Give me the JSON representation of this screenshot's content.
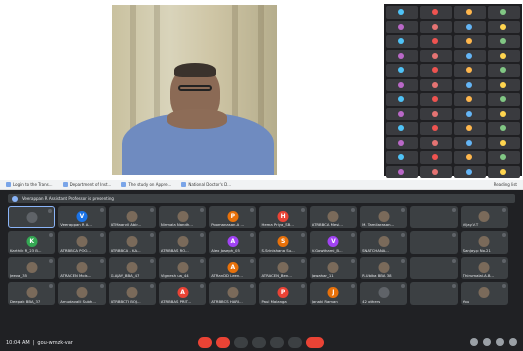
{
  "thumb_grid": {
    "rows": 13,
    "dot_colors": [
      "#4fc3f7",
      "#ef5350",
      "#ffb74d",
      "#81c784",
      "#ba68c8",
      "#e57373",
      "#64b5f6",
      "#ffd54f"
    ]
  },
  "browser": {
    "bookmarks": [
      {
        "label": "Login to the Trans..."
      },
      {
        "label": "Department of Inst..."
      },
      {
        "label": "The study on Appre..."
      },
      {
        "label": "National Doctor's D..."
      }
    ],
    "reading_list": "Reading list"
  },
  "meet": {
    "presenting_banner": "Veerappan R Assistant Professor is presenting",
    "tiles": [
      {
        "name": "",
        "initial": "",
        "color": "#5f6368",
        "presenting": true
      },
      {
        "name": "Veerappan R A...",
        "initial": "V",
        "color": "#1a73e8"
      },
      {
        "name": "ATMaarvil Abir...",
        "initial": "",
        "color": "#7a6a5a"
      },
      {
        "name": "Nirmala Nandh...",
        "initial": "",
        "color": "#7a6a5a"
      },
      {
        "name": "Poomanasan.A ...",
        "initial": "P",
        "color": "#e8710a"
      },
      {
        "name": "Hema Priya_SB...",
        "initial": "H",
        "color": "#ea4335"
      },
      {
        "name": "ATRBBCA Mesi...",
        "initial": "",
        "color": "#7a6a5a"
      },
      {
        "name": "M. Tamilarasan...",
        "initial": "",
        "color": "#7a6a5a"
      },
      {
        "name": "",
        "initial": "",
        "color": "#3c4043"
      },
      {
        "name": "Vijay.V.T",
        "initial": "",
        "color": "#7a6a5a"
      },
      {
        "name": "Karthik R_23 B...",
        "initial": "K",
        "color": "#34a853"
      },
      {
        "name": "ATRBBCA POO...",
        "initial": "",
        "color": "#7a6a5a"
      },
      {
        "name": "ATRBBCA - KA...",
        "initial": "",
        "color": "#7a6a5a"
      },
      {
        "name": "ATRBBAS RO...",
        "initial": "",
        "color": "#7a6a5a"
      },
      {
        "name": "Alex Joseph_05",
        "initial": "A",
        "color": "#a142f4"
      },
      {
        "name": "S.Srinishana Su...",
        "initial": "S",
        "color": "#e8710a"
      },
      {
        "name": "V.Gowthami_B...",
        "initial": "V",
        "color": "#a142f4"
      },
      {
        "name": "SNATCHANA...",
        "initial": "",
        "color": "#7a6a5a"
      },
      {
        "name": "",
        "initial": "",
        "color": "#3c4043"
      },
      {
        "name": "Sanjay.p No.21",
        "initial": "",
        "color": "#7a6a5a"
      },
      {
        "name": "Jeeva_35",
        "initial": "",
        "color": "#7a6a5a"
      },
      {
        "name": "ATRACEN Mois...",
        "initial": "",
        "color": "#7a6a5a"
      },
      {
        "name": "G.AJAY_BBA_47",
        "initial": "",
        "color": "#7a6a5a"
      },
      {
        "name": "Vignesh ua_44",
        "initial": "",
        "color": "#7a6a5a"
      },
      {
        "name": "ATRanDD Leen...",
        "initial": "A",
        "color": "#e8710a"
      },
      {
        "name": "ATRACEN_Ben...",
        "initial": "",
        "color": "#7a6a5a"
      },
      {
        "name": "Jawahar_11",
        "initial": "",
        "color": "#7a6a5a"
      },
      {
        "name": "R.Ubika BBA 38",
        "initial": "",
        "color": "#7a6a5a"
      },
      {
        "name": "",
        "initial": "",
        "color": "#3c4043"
      },
      {
        "name": "Thirumalai.A.B...",
        "initial": "",
        "color": "#7a6a5a"
      },
      {
        "name": "Deepak BBA_37",
        "initial": "",
        "color": "#7a6a5a"
      },
      {
        "name": "Amudavalli Subh...",
        "initial": "",
        "color": "#7a6a5a"
      },
      {
        "name": "ATRBBCTI BOJ...",
        "initial": "",
        "color": "#7a6a5a"
      },
      {
        "name": "ATRBBAS PRIT...",
        "initial": "A",
        "color": "#ea4335"
      },
      {
        "name": "ATRBBCS HARI...",
        "initial": "",
        "color": "#7a6a5a"
      },
      {
        "name": "Paul Malanga",
        "initial": "P",
        "color": "#ea4335"
      },
      {
        "name": "Janaki Raman",
        "initial": "J",
        "color": "#e8710a"
      },
      {
        "name": "42 others",
        "initial": "",
        "color": "#5f6368"
      },
      {
        "name": "",
        "initial": "",
        "color": "#3c4043"
      },
      {
        "name": "You",
        "initial": "",
        "color": "#7a6a5a"
      }
    ],
    "time": "10:04 AM",
    "separator": "|",
    "meeting_code": "gou-wmzk-var"
  }
}
